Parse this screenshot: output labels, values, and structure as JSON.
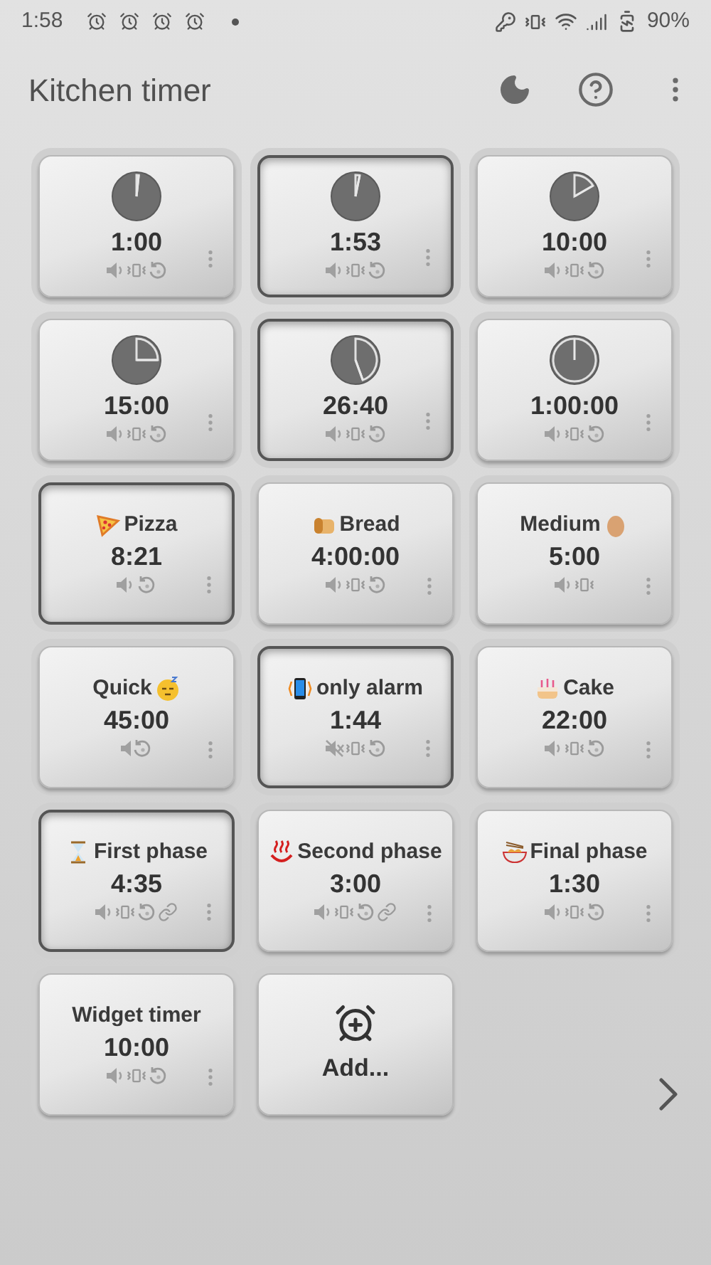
{
  "status_bar": {
    "time": "1:58",
    "battery": "90%"
  },
  "app_bar": {
    "title": "Kitchen timer"
  },
  "timers": [
    {
      "kind": "clock",
      "time": "1:00",
      "running": false,
      "sound": true,
      "quiet": false,
      "muted": false,
      "vibrate": true,
      "repeat": true,
      "linked": false
    },
    {
      "kind": "clock",
      "time": "1:53",
      "running": true,
      "sound": true,
      "quiet": false,
      "muted": false,
      "vibrate": true,
      "repeat": true,
      "linked": false
    },
    {
      "kind": "clock",
      "time": "10:00",
      "running": false,
      "sound": true,
      "quiet": false,
      "muted": false,
      "vibrate": true,
      "repeat": true,
      "linked": false
    },
    {
      "kind": "clock",
      "time": "15:00",
      "running": false,
      "sound": true,
      "quiet": false,
      "muted": false,
      "vibrate": true,
      "repeat": true,
      "linked": false
    },
    {
      "kind": "clock",
      "time": "26:40",
      "running": true,
      "sound": true,
      "quiet": false,
      "muted": false,
      "vibrate": true,
      "repeat": true,
      "linked": false
    },
    {
      "kind": "clock",
      "time": "1:00:00",
      "running": false,
      "sound": true,
      "quiet": false,
      "muted": false,
      "vibrate": true,
      "repeat": true,
      "linked": false
    },
    {
      "kind": "pizza",
      "label": "Pizza",
      "icon_after": false,
      "time": "8:21",
      "running": true,
      "sound": true,
      "quiet": false,
      "muted": false,
      "vibrate": false,
      "repeat": true,
      "linked": false
    },
    {
      "kind": "bread",
      "label": "Bread",
      "icon_after": false,
      "time": "4:00:00",
      "running": false,
      "sound": true,
      "quiet": false,
      "muted": false,
      "vibrate": true,
      "repeat": true,
      "linked": false
    },
    {
      "kind": "egg",
      "label": "Medium",
      "icon_after": true,
      "time": "5:00",
      "running": false,
      "sound": true,
      "quiet": false,
      "muted": false,
      "vibrate": true,
      "repeat": false,
      "linked": false
    },
    {
      "kind": "sleepy",
      "label": "Quick",
      "icon_after": true,
      "time": "45:00",
      "running": false,
      "sound": true,
      "quiet": true,
      "muted": false,
      "vibrate": false,
      "repeat": true,
      "linked": false
    },
    {
      "kind": "phone",
      "label": "only alarm",
      "icon_after": false,
      "time": "1:44",
      "running": true,
      "sound": true,
      "quiet": false,
      "muted": true,
      "vibrate": true,
      "repeat": true,
      "linked": false
    },
    {
      "kind": "cake",
      "label": "Cake",
      "icon_after": false,
      "time": "22:00",
      "running": false,
      "sound": true,
      "quiet": false,
      "muted": false,
      "vibrate": true,
      "repeat": true,
      "linked": false
    },
    {
      "kind": "hourglass",
      "label": "First phase",
      "icon_after": false,
      "time": "4:35",
      "running": true,
      "sound": true,
      "quiet": false,
      "muted": false,
      "vibrate": true,
      "repeat": true,
      "linked": true
    },
    {
      "kind": "springs",
      "label": "Second phase",
      "icon_after": false,
      "time": "3:00",
      "running": false,
      "sound": true,
      "quiet": false,
      "muted": false,
      "vibrate": true,
      "repeat": true,
      "linked": true
    },
    {
      "kind": "noodles",
      "label": "Final phase",
      "icon_after": false,
      "time": "1:30",
      "running": false,
      "sound": true,
      "quiet": false,
      "muted": false,
      "vibrate": true,
      "repeat": true,
      "linked": false
    },
    {
      "kind": "plain",
      "label": "Widget timer",
      "time": "10:00",
      "running": false,
      "sound": true,
      "quiet": false,
      "muted": false,
      "vibrate": true,
      "repeat": true,
      "linked": false
    }
  ],
  "add_tile": {
    "label": "Add..."
  }
}
